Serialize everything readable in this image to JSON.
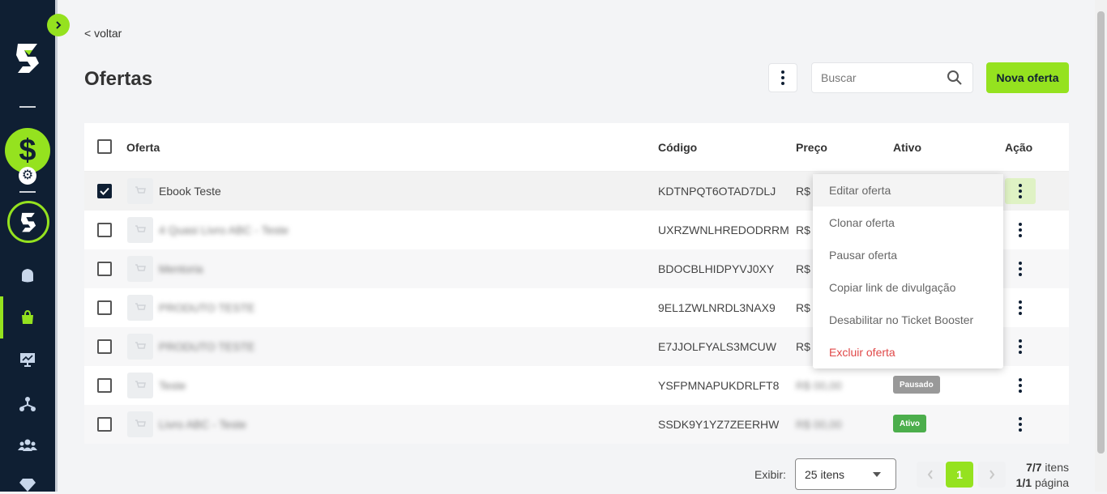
{
  "nav": {
    "back_label": "< voltar"
  },
  "page": {
    "title": "Ofertas"
  },
  "toolbar": {
    "search_placeholder": "Buscar",
    "new_offer_label": "Nova oferta"
  },
  "table": {
    "headers": {
      "offer": "Oferta",
      "code": "Código",
      "price": "Preço",
      "active": "Ativo",
      "action": "Ação"
    },
    "rows": [
      {
        "name": "Ebook Teste",
        "code": "KDTNPQT6OTAD7DLJ",
        "price": "R$",
        "status": "",
        "checked": true
      },
      {
        "name": "4 Quasi Livro ABC - Teste",
        "code": "UXRZWNLHREDODRRM",
        "price": "R$",
        "status": "",
        "checked": false
      },
      {
        "name": "Mentoria",
        "code": "BDOCBLHIDPYVJ0XY",
        "price": "R$",
        "status": "",
        "checked": false
      },
      {
        "name": "PRODUTO TESTE",
        "code": "9EL1ZWLNRDL3NAX9",
        "price": "R$",
        "status": "",
        "checked": false
      },
      {
        "name": "PRODUTO TESTE",
        "code": "E7JJOLFYALS3MCUW",
        "price": "R$",
        "status": "",
        "checked": false
      },
      {
        "name": "Teste",
        "code": "YSFPMNAPUKDRLFT8",
        "price": "R$ 00,00",
        "status": "Pausado",
        "checked": false
      },
      {
        "name": "Livro ABC - Teste",
        "code": "SSDK9Y1YZ7ZEERHW",
        "price": "R$ 00,00",
        "status": "Ativo",
        "checked": false
      }
    ]
  },
  "menu": {
    "items": [
      "Editar oferta",
      "Clonar oferta",
      "Pausar oferta",
      "Copiar link de divulgação",
      "Desabilitar no Ticket Booster",
      "Excluir oferta"
    ]
  },
  "footer": {
    "show_label": "Exibir:",
    "page_size": "25 itens",
    "current_page": "1",
    "items_count": "7/7",
    "items_label": " itens",
    "pages_count": "1/1",
    "pages_label": " página"
  },
  "colors": {
    "accent": "#95e21f",
    "sidebar": "#0f1f33",
    "danger": "#e04848",
    "paused": "#999999",
    "active": "#4cae4c"
  },
  "icons": {
    "expand": "chevron-right-icon",
    "logo": "brand-s-logo",
    "money": "dollar-icon",
    "settings": "gear-icon",
    "home": "home-icon",
    "bag": "shopping-bag-icon",
    "presentation": "presentation-icon",
    "network": "network-icon",
    "users": "users-icon",
    "diamond": "diamond-icon",
    "search": "search-icon",
    "more": "kebab-menu-icon",
    "cart": "cart-icon"
  }
}
